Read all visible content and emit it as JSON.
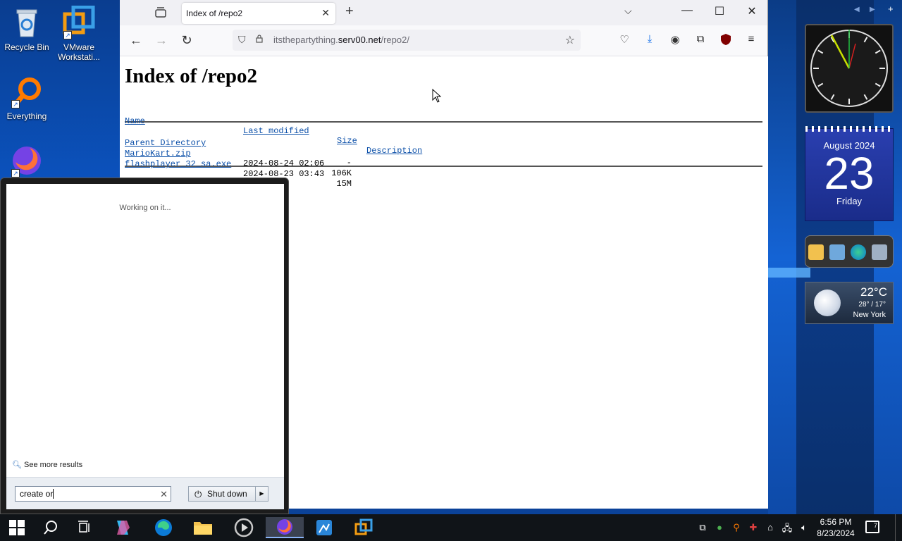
{
  "desktop": {
    "icons": [
      {
        "label": "Recycle Bin",
        "icon": "recycle-bin-icon"
      },
      {
        "label": "VMware Workstati...",
        "icon": "vmware-icon"
      },
      {
        "label": "Everything",
        "icon": "everything-search-icon"
      },
      {
        "label": "",
        "icon": "firefox-icon"
      }
    ]
  },
  "browser": {
    "tab_title": "Index of /repo2",
    "url_prefix": "itsthepartything.",
    "url_host": "serv00.net",
    "url_path": "/repo2/",
    "page": {
      "heading": "Index of /repo2",
      "columns": {
        "name": "Name",
        "modified": "Last modified",
        "size": "Size",
        "description": "Description"
      },
      "rows": [
        {
          "name": "Parent Directory",
          "modified": "",
          "size": "-"
        },
        {
          "name": "MarioKart.zip",
          "modified": "2024-08-24 02:06",
          "size": "106K"
        },
        {
          "name": "flashplayer_32_sa.exe",
          "modified": "2024-08-23 03:43",
          "size": "15M"
        }
      ]
    }
  },
  "start_menu": {
    "status": "Working on it...",
    "see_more": "See more results",
    "search_value": "create or",
    "shutdown_label": "Shut down"
  },
  "gadgets": {
    "calendar": {
      "month": "August 2024",
      "day": "23",
      "weekday": "Friday"
    },
    "weather": {
      "temp": "22°C",
      "range": "28° / 17°",
      "city": "New York"
    }
  },
  "taskbar": {
    "time": "6:56 PM",
    "date": "8/23/2024",
    "notifications": "7",
    "colors": {
      "background": "#101418",
      "active": "#3b4250"
    }
  }
}
